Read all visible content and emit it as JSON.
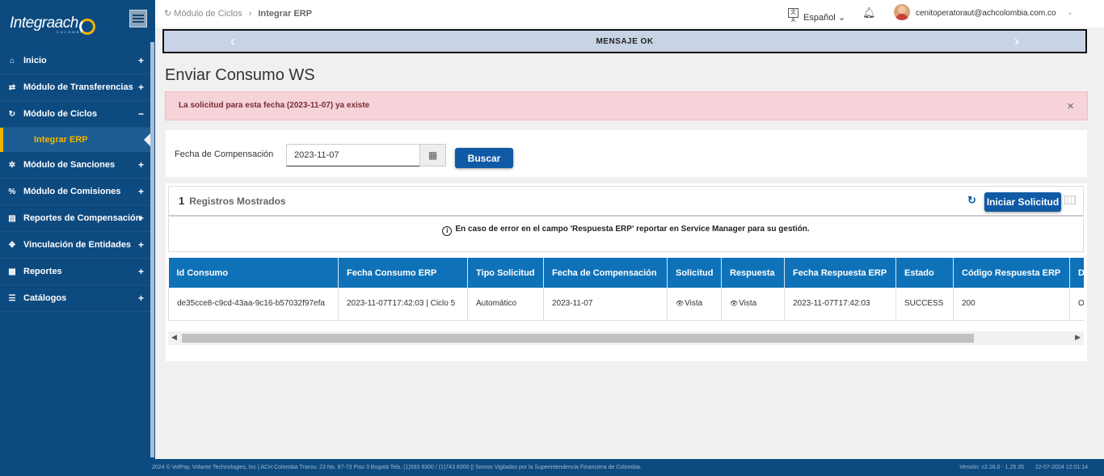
{
  "app": {
    "logo_text": "Integraach",
    "logo_sub": "COLOMBIA"
  },
  "sidebar": {
    "items": [
      {
        "label": "Inicio",
        "icon": "home-icon",
        "glyph": "⌂",
        "toggle": "+"
      },
      {
        "label": "Módulo de Transferencias",
        "icon": "exchange-icon",
        "glyph": "⇄",
        "toggle": "+"
      },
      {
        "label": "Módulo de Ciclos",
        "icon": "refresh-icon",
        "glyph": "↻",
        "toggle": "−"
      },
      {
        "label": "Módulo de Sanciones",
        "icon": "gear-icon",
        "glyph": "✲",
        "toggle": "+"
      },
      {
        "label": "Módulo de Comisiones",
        "icon": "percent-icon",
        "glyph": "%",
        "toggle": "+"
      },
      {
        "label": "Reportes de Compensación",
        "icon": "document-icon",
        "glyph": "▤",
        "toggle": "+"
      },
      {
        "label": "Vinculación de Entidades",
        "icon": "link-icon",
        "glyph": "✥",
        "toggle": "+"
      },
      {
        "label": "Reportes",
        "icon": "report-icon",
        "glyph": "▦",
        "toggle": "+"
      },
      {
        "label": "Catálogos",
        "icon": "list-icon",
        "glyph": "☰",
        "toggle": "+"
      }
    ],
    "active_sub": "Integrar ERP"
  },
  "header": {
    "breadcrumb": [
      "Módulo de Ciclos",
      "Integrar ERP"
    ],
    "language": "Español",
    "user_email": "cenitoperatoraut@achcolombia.com.co"
  },
  "message_bar": {
    "text": "MENSAJE OK"
  },
  "page": {
    "title": "Enviar Consumo WS"
  },
  "alert": {
    "text": "La solicitud para esta fecha (2023-11-07) ya existe",
    "close": "×"
  },
  "form": {
    "label": "Fecha de Compensación",
    "date_value": "2023-11-07",
    "search_label": "Buscar"
  },
  "grid": {
    "count": "1",
    "count_label": "Registros Mostrados",
    "action_label": "Iniciar Solicitud",
    "note": "En caso de error en el campo 'Respuesta ERP' reportar en Service Manager para su gestión.",
    "columns": [
      "Id Consumo",
      "Fecha Consumo ERP",
      "Tipo Solicitud",
      "Fecha de Compensación",
      "Solicitud",
      "Respuesta",
      "Fecha Respuesta ERP",
      "Estado",
      "Código Respuesta ERP",
      "De"
    ],
    "rows": [
      [
        "de35cce8-c9cd-43aa-9c16-b57032f97efa",
        "2023-11-07T17:42:03 | Ciclo 5",
        "Automático",
        "2023-11-07",
        "Vista",
        "Vista",
        "2023-11-07T17:42:03",
        "SUCCESS",
        "200",
        "Ol"
      ]
    ]
  },
  "footer": {
    "left": "2024 © VolPay, Volante Technologies, Inc | ACH Colombia Transv. 23 No. 97-73 Piso 3 Bogotá Tels. (1)593 8300 / (1)743 8300 || Somos Vigilados por la Superintendencia Financiera de Colombia.",
    "version": "Versión: c2.26.0 - 1.25.35",
    "datetime": "22-07-2024 12:01:14"
  },
  "colors": {
    "sidebar": "#0d4a80",
    "accent": "#f5b400",
    "primary_button": "#0f5aa5",
    "table_header": "#0f72b8",
    "alert_bg": "#f5d3d8"
  }
}
